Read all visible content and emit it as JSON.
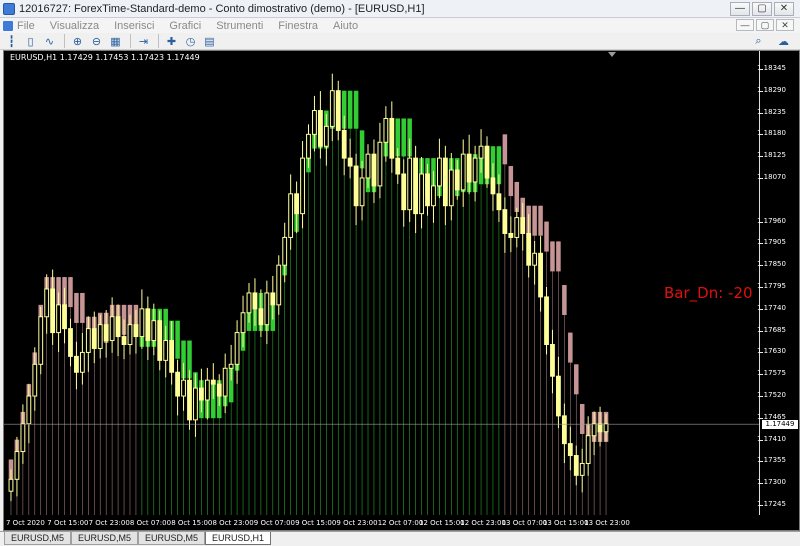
{
  "window": {
    "title": "12016727: ForexTime-Standard-demo - Conto dimostrativo (demo) - [EURUSD,H1]",
    "buttons": [
      "—",
      "▢",
      "✕"
    ]
  },
  "menu": {
    "items": [
      "File",
      "Visualizza",
      "Inserisci",
      "Grafici",
      "Strumenti",
      "Finestra",
      "Aiuto"
    ],
    "right_buttons": [
      "—",
      "▢",
      "✕"
    ]
  },
  "toolbar": {
    "icons": [
      "bar-chart-icon",
      "candle-chart-icon",
      "line-chart-icon",
      "zoom-in-icon",
      "zoom-out-icon",
      "tile-windows-icon",
      "chart-shift-icon",
      "add-indicator-icon",
      "timeframe-icon",
      "templates-icon"
    ],
    "right_icons": [
      "search-icon",
      "chat-icon"
    ]
  },
  "chart": {
    "header": "EURUSD,H1  1.17429 1.17453 1.17423 1.17449",
    "indicator_label": "Bar_Dn:  -20",
    "current_price": "1.17449",
    "colors": {
      "bull": "#ffff99",
      "up_band": "#32cd32",
      "down_band": "#c69494",
      "indicator_text": "#e01010"
    }
  },
  "chart_data": {
    "type": "candlestick",
    "symbol": "EURUSD",
    "timeframe": "H1",
    "y_ticks": [
      "1.18345",
      "1.18290",
      "1.18235",
      "1.18180",
      "1.18125",
      "1.18070",
      "1.17960",
      "1.17905",
      "1.17850",
      "1.17795",
      "1.17740",
      "1.17685",
      "1.17630",
      "1.17575",
      "1.17520",
      "1.17465",
      "1.17410",
      "1.17355",
      "1.17300",
      "1.17245"
    ],
    "ylim": [
      1.1722,
      1.1837
    ],
    "x_ticks": [
      "7 Oct 2020",
      "7 Oct 15:00",
      "7 Oct 23:00",
      "8 Oct 07:00",
      "8 Oct 15:00",
      "8 Oct 23:00",
      "9 Oct 07:00",
      "9 Oct 15:00",
      "9 Oct 23:00",
      "12 Oct 07:00",
      "12 Oct 15:00",
      "12 Oct 23:00",
      "13 Oct 07:00",
      "13 Oct 15:00",
      "13 Oct 23:00"
    ],
    "close": [
      1.1731,
      1.1738,
      1.1745,
      1.1752,
      1.176,
      1.1772,
      1.1779,
      1.1768,
      1.1775,
      1.1769,
      1.1762,
      1.1758,
      1.1763,
      1.1769,
      1.1764,
      1.177,
      1.1766,
      1.1772,
      1.1767,
      1.1765,
      1.177,
      1.1767,
      1.1774,
      1.1766,
      1.1771,
      1.1761,
      1.1766,
      1.1758,
      1.1752,
      1.1756,
      1.1746,
      1.1754,
      1.1751,
      1.1756,
      1.1755,
      1.1752,
      1.1759,
      1.176,
      1.1768,
      1.1773,
      1.1778,
      1.1774,
      1.177,
      1.1778,
      1.1775,
      1.1785,
      1.1792,
      1.1803,
      1.1798,
      1.1812,
      1.1818,
      1.1824,
      1.1815,
      1.182,
      1.1829,
      1.1819,
      1.1812,
      1.181,
      1.18,
      1.1807,
      1.1813,
      1.1805,
      1.1816,
      1.1822,
      1.1812,
      1.1808,
      1.1799,
      1.1812,
      1.1798,
      1.1808,
      1.18,
      1.1805,
      1.1812,
      1.18,
      1.1809,
      1.1804,
      1.1813,
      1.1806,
      1.1812,
      1.1815,
      1.1807,
      1.1803,
      1.1799,
      1.1793,
      1.1792,
      1.1797,
      1.1793,
      1.1785,
      1.1788,
      1.1777,
      1.1765,
      1.1757,
      1.1747,
      1.174,
      1.1737,
      1.1732,
      1.1735,
      1.1742,
      1.1745,
      1.1743,
      1.1745
    ],
    "up_band_top": [],
    "down_band_top": []
  },
  "tabs": [
    {
      "label": "EURUSD,M5",
      "active": false
    },
    {
      "label": "EURUSD,M5",
      "active": false
    },
    {
      "label": "EURUSD,M5",
      "active": false
    },
    {
      "label": "EURUSD,H1",
      "active": true
    }
  ]
}
